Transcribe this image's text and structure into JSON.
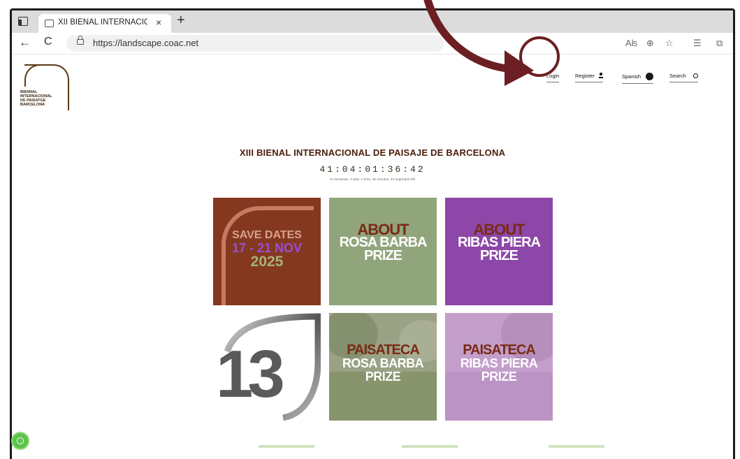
{
  "browser": {
    "tab_title": "XII BIENAL INTERNACIONAL DE PAISAJE",
    "tab_close": "×",
    "new_tab": "+",
    "url": "https://landscape.coac.net",
    "nav": {
      "back": "←",
      "reload": "C"
    },
    "toolbar": {
      "read_aloud": "Aʪ",
      "zoom": "⊕",
      "favorite": "☆",
      "favorites": "☰",
      "collections": "⧉"
    }
  },
  "site": {
    "logo_text": "BIENNAL\nINTERNACIONAL\nDE PAISATGE\nBARCELONA",
    "menu": {
      "login": "Login",
      "register": "Register",
      "language": "Spanish",
      "search": "Search"
    },
    "title": "XIII BIENAL INTERNACIONAL DE PAISAJE DE BARCELONA",
    "countdown": "41:04:01:36:42",
    "countdown_sub": "41 semanas, 4 días, 1 hora, 36 minutos, 42 segundos left",
    "tiles": [
      {
        "lines": [
          "SAVE DATES",
          "17 - 21 NOV",
          "",
          "2025"
        ]
      },
      {
        "lines": [
          "ABOUT",
          "ROSA BARBA",
          "PRIZE"
        ]
      },
      {
        "lines": [
          "ABOUT",
          "RIBAS PIERA",
          "PRIZE"
        ]
      },
      {
        "lines": [
          "13"
        ]
      },
      {
        "lines": [
          "PAISATECA",
          "ROSA BARBA",
          "PRIZE"
        ]
      },
      {
        "lines": [
          "PAISATECA",
          "RIBAS PIERA",
          "PRIZE"
        ]
      }
    ]
  },
  "colors": {
    "brand_brown": "#5b3a14",
    "annotation": "#6b1f22",
    "tile_save": "#843820",
    "tile_about_rb": "#91a57c",
    "tile_about_rp": "#8d47a8",
    "accent_purple": "#9a4fd0",
    "accent_green": "#a4b27a",
    "accent_rust": "#7a2a14"
  },
  "icons": {
    "user": "user-icon",
    "globe": "globe-icon",
    "search": "search-icon",
    "cookie": "cookie-icon",
    "annotation_arrow": "curved-arrow-icon"
  }
}
